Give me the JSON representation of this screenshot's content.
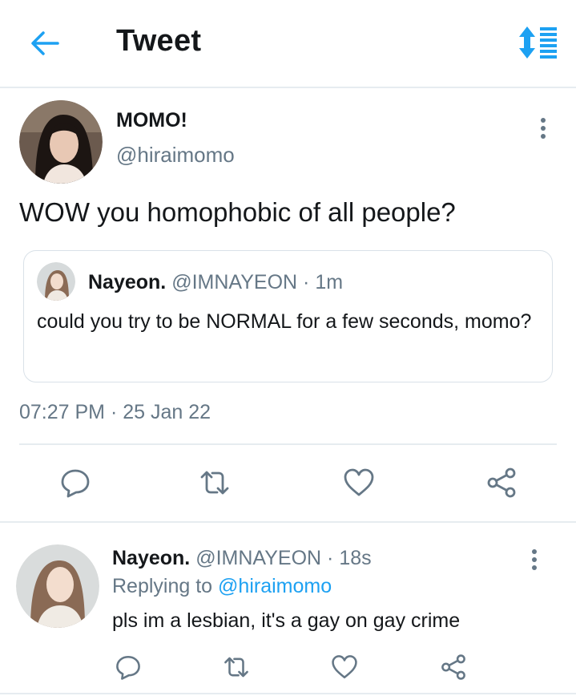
{
  "header": {
    "title": "Tweet"
  },
  "tweet": {
    "display_name": "MOMO!",
    "handle": "@hiraimomo",
    "text": "WOW you homophobic of all people?",
    "timestamp": "07:27 PM · 25 Jan 22",
    "quoted": {
      "display_name": "Nayeon.",
      "handle": "@IMNAYEON",
      "time": "· 1m",
      "text": "could you try to be NORMAL for a few seconds, momo?"
    }
  },
  "reply": {
    "display_name": "Nayeon.",
    "handle": "@IMNAYEON",
    "time": "· 18s",
    "replying_prefix": "Replying to",
    "replying_to": "@hiraimomo",
    "text": "pls im a lesbian, it's a gay on gay crime"
  },
  "colors": {
    "accent": "#1da1f2",
    "secondary_text": "#657786",
    "icon_gray": "#657786",
    "divider": "#e6ecf0"
  },
  "icons": {
    "back": "arrow-left-icon",
    "sort": "sort-icon",
    "more": "more-vertical-icon",
    "reply": "reply-icon",
    "retweet": "retweet-icon",
    "like": "heart-icon",
    "share": "share-icon"
  }
}
